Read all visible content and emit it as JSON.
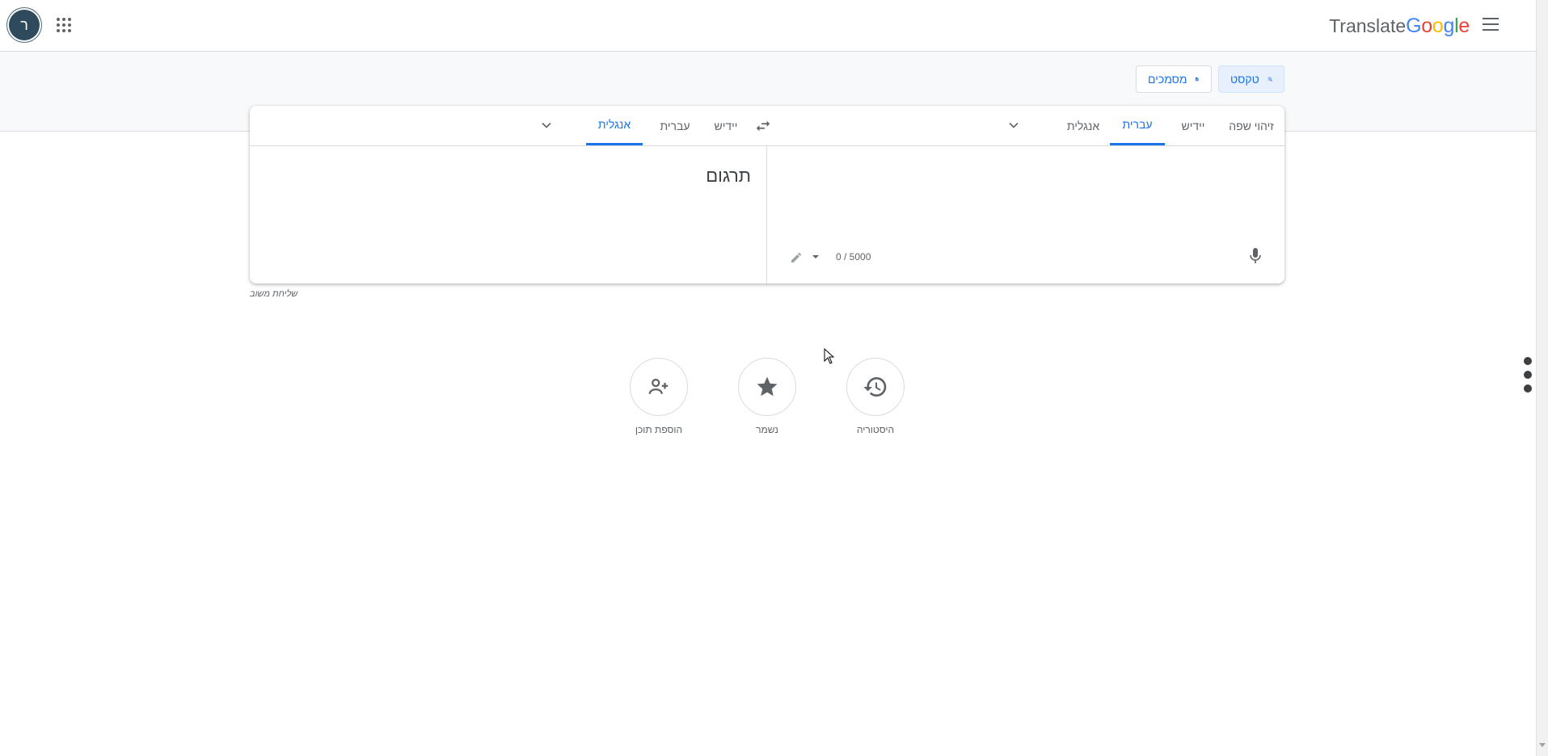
{
  "header": {
    "avatar_letter": "ר",
    "logo_word": "Translate",
    "logo_brand": [
      "G",
      "o",
      "o",
      "g",
      "l",
      "e"
    ],
    "logo_colors": [
      "#4285f4",
      "#ea4335",
      "#fbbc05",
      "#4285f4",
      "#34a853",
      "#ea4335"
    ]
  },
  "modes": {
    "text_label": "טקסט",
    "documents_label": "מסמכים"
  },
  "source_langs": {
    "detect": "זיהוי שפה",
    "yiddish": "יידיש",
    "hebrew": "עברית",
    "english": "אנגלית",
    "selected": "עברית"
  },
  "target_langs": {
    "yiddish": "יידיש",
    "hebrew": "עברית",
    "english": "אנגלית",
    "selected": "אנגלית"
  },
  "target": {
    "placeholder": "תרגום"
  },
  "source": {
    "counter": "0 / 5000"
  },
  "feedback_label": "שליחת משוב",
  "quick_actions": {
    "history": "היסטוריה",
    "saved": "נשמר",
    "contribute": "הוספת תוכן"
  },
  "colors": {
    "accent": "#1a73e8",
    "icon_gray": "#5f6368"
  },
  "icons": {
    "menu": "hamburger-menu-icon",
    "apps": "apps-grid-icon",
    "translate": "translate-icon",
    "document": "document-icon",
    "swap": "swap-arrows-icon",
    "mic": "microphone-icon",
    "pencil": "pencil-icon",
    "history": "history-icon",
    "saved": "star-icon",
    "contribute": "contribute-people-icon"
  }
}
